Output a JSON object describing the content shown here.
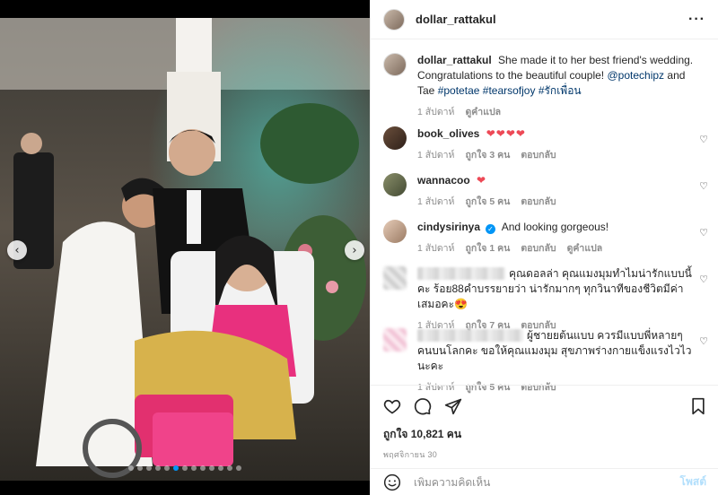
{
  "post": {
    "username": "dollar_rattakul",
    "caption": {
      "text": "She made it to her best friend's wedding. Congratulations to the beautiful couple!",
      "mention": "@potechipz",
      "and_text": "and Tae",
      "hashtags": [
        "#potetae",
        "#tearsofjoy",
        "#รักเพื่อน"
      ]
    },
    "caption_meta": {
      "time": "1 สัปดาห์",
      "translate": "ดูคำแปล"
    },
    "likes": "ถูกใจ 10,821 คน",
    "date": "พฤศจิกายน 30",
    "photo_count": 13,
    "active_photo": 5,
    "nav_prev": "‹",
    "nav_next": "›"
  },
  "comments": [
    {
      "username": "book_olives",
      "text": "",
      "hearts": "❤❤❤❤",
      "time": "1 สัปดาห์",
      "likes": "ถูกใจ 3 คน",
      "reply": "ตอบกลับ"
    },
    {
      "username": "wannacoo",
      "text": "",
      "hearts": "❤",
      "time": "1 สัปดาห์",
      "likes": "ถูกใจ 5 คน",
      "reply": "ตอบกลับ"
    },
    {
      "username": "cindysirinya",
      "text": "And looking gorgeous!",
      "time": "1 สัปดาห์",
      "likes": "ถูกใจ 1 คน",
      "reply": "ตอบกลับ",
      "translate": "ดูคำแปล"
    },
    {
      "username": "",
      "text": "คุณดอลล่า คุณแมงมุมทำไมน่ารักแบบนี้คะ ร้อย88คำบรรยายว่า น่ารักมากๆ ทุกวินาทีของชีวิตมีค่าเสมอคะ😍",
      "time": "1 สัปดาห์",
      "likes": "ถูกใจ 7 คน",
      "reply": "ตอบกลับ"
    },
    {
      "username": "",
      "text": "ผู้ชายยต้นแบบ ควรมีแบบพี่หลายๆคนบนโลกคะ ขอให้คุณแมงมุม สุขภาพร่างกายแข็งแรงไวไวนะคะ",
      "time": "1 สัปดาห์",
      "likes": "ถูกใจ 5 คน",
      "reply": "ตอบกลับ"
    }
  ],
  "add_comment": {
    "placeholder": "เพิ่มความคิดเห็น",
    "post_label": "โพสต์"
  },
  "icons": [
    "more-icon",
    "heart-icon",
    "comment-icon",
    "share-icon",
    "bookmark-icon",
    "emoji-icon"
  ],
  "colors": {
    "link": "#00376b",
    "heart_red": "#ed4956",
    "verified": "#0095f6",
    "post_button_disabled": "#b2dffc",
    "muted": "#8e8e8e"
  }
}
